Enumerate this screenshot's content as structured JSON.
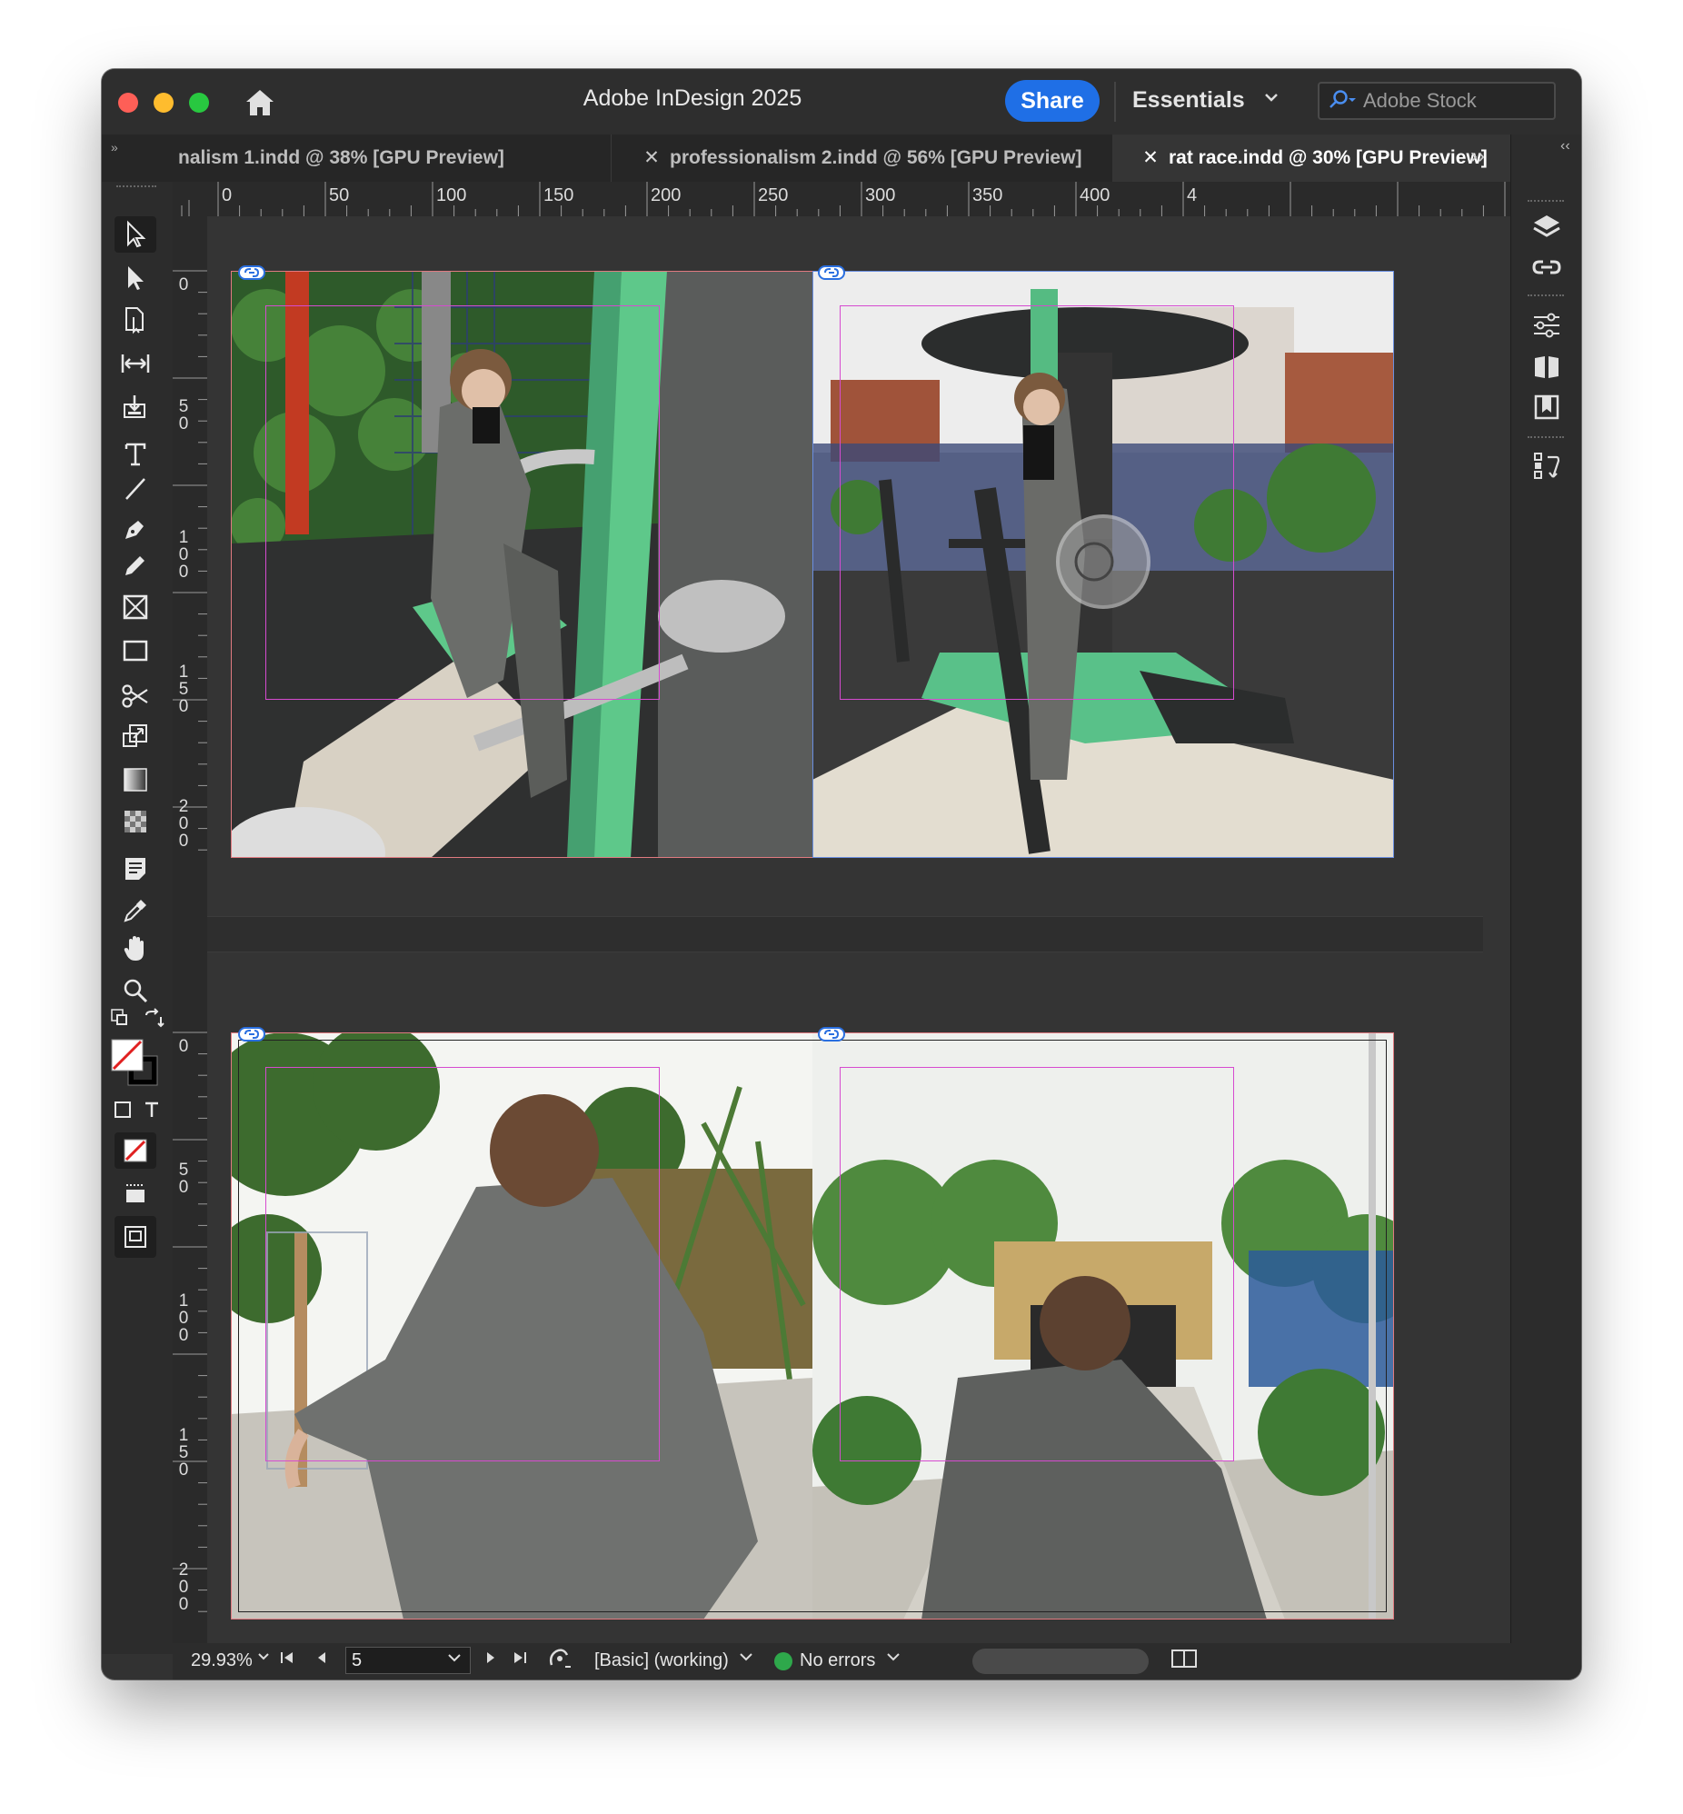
{
  "app": {
    "title": "Adobe InDesign 2025",
    "share_label": "Share",
    "workspace_label": "Essentials",
    "stock_placeholder": "Adobe Stock"
  },
  "tabs": [
    {
      "label": "nalism 1.indd @ 38% [GPU Preview]",
      "active": false
    },
    {
      "label": "professionalism 2.indd @ 56% [GPU Preview]",
      "active": false
    },
    {
      "label": "rat race.indd @ 30% [GPU Preview]",
      "active": true
    }
  ],
  "ruler": {
    "top": [
      "0",
      "50",
      "100",
      "150",
      "200",
      "250",
      "300",
      "350",
      "400",
      "4"
    ],
    "left_spread1": [
      "0",
      "50",
      "100",
      "150",
      "200"
    ],
    "left_spread2": [
      "0",
      "50",
      "100",
      "150",
      "200"
    ]
  },
  "status": {
    "zoom": "29.93%",
    "page": "5",
    "preflight_profile": "[Basic] (working)",
    "errors": "No errors"
  },
  "colors": {
    "accent": "#1f6fe6",
    "status_ok": "#2ea84b",
    "margin_guide": "#d64bd0"
  },
  "icons": {
    "toolbar": [
      "selection-tool-icon",
      "direct-selection-tool-icon",
      "page-tool-icon",
      "gap-tool-icon",
      "content-collector-icon",
      "type-tool-icon",
      "line-tool-icon",
      "pen-tool-icon",
      "pencil-tool-icon",
      "rectangle-frame-tool-icon",
      "rectangle-tool-icon",
      "scissors-tool-icon",
      "free-transform-tool-icon",
      "gradient-swatch-tool-icon",
      "gradient-feather-tool-icon",
      "note-tool-icon",
      "eyedropper-tool-icon",
      "hand-tool-icon",
      "zoom-tool-icon"
    ],
    "right_panel": [
      "layers-icon",
      "links-icon",
      "properties-icon",
      "pages-icon",
      "cc-libraries-icon",
      "text-wrap-icon"
    ]
  }
}
